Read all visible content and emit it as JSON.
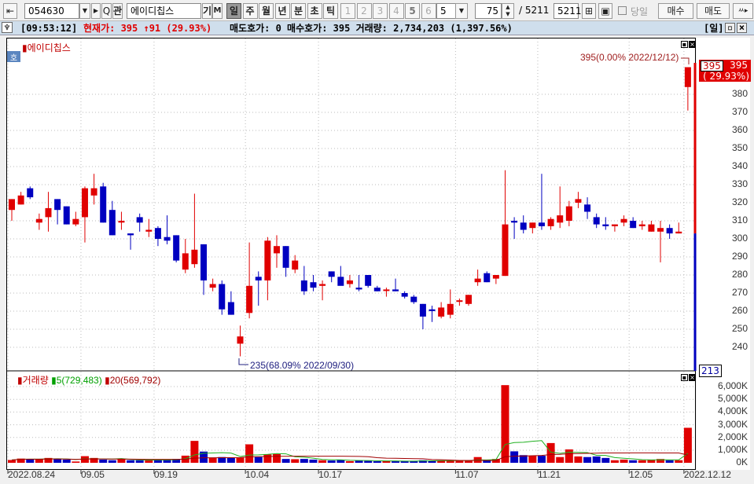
{
  "toolbar": {
    "code": "054630",
    "name": "에이디칩스",
    "gi": "기",
    "m": "M",
    "search": "Q",
    "gwan": "관",
    "periods": [
      "일",
      "주",
      "월",
      "년",
      "분",
      "초",
      "틱"
    ],
    "active_period": "일",
    "nums": [
      "1",
      "2",
      "3",
      "4",
      "5",
      "6"
    ],
    "num_select": "5",
    "count": "75",
    "total": "/ 5211",
    "total_box": "5211",
    "today_label": "당일",
    "buy": "매수",
    "sell": "매도",
    "more": "ㅆ▸"
  },
  "info": {
    "time": "[09:53:12]",
    "current": "현재가: 395 ↑91 (29.93%)",
    "rest": "매도호가: 0 매수호가: 395 거래량: 2,734,203 (1,397.56%)",
    "period": "[일]"
  },
  "chart_data": {
    "type": "candlestick",
    "title": "에이디칩스",
    "price_axis": [
      "380",
      "370",
      "360",
      "350",
      "340",
      "330",
      "320",
      "310",
      "300",
      "290",
      "280",
      "270",
      "260",
      "250",
      "240"
    ],
    "price_range": [
      225,
      400
    ],
    "high_label": "395(0.00% 2022/12/12)",
    "low_label": "235(68.09% 2022/09/30)",
    "current_tag": "395",
    "current_price": "395",
    "current_pct": "( 29.93%)",
    "range_low_tag": "213",
    "colors": {
      "up": "#e00000",
      "down": "#0000c0"
    },
    "ohlc": [
      [
        316,
        322,
        310,
        322
      ],
      [
        319,
        326,
        319,
        324
      ],
      [
        328,
        329,
        322,
        323
      ],
      [
        309,
        314,
        305,
        311
      ],
      [
        312,
        326,
        304,
        317
      ],
      [
        322,
        322,
        308,
        316
      ],
      [
        318,
        318,
        308,
        308
      ],
      [
        308,
        315,
        307,
        311
      ],
      [
        312,
        329,
        298,
        328
      ],
      [
        324,
        336,
        319,
        328
      ],
      [
        329,
        331,
        309,
        309
      ],
      [
        316,
        321,
        302,
        302
      ],
      [
        309,
        315,
        305,
        310
      ],
      [
        303,
        303,
        294,
        302
      ],
      [
        312,
        314,
        304,
        309
      ],
      [
        304,
        311,
        301,
        305
      ],
      [
        306,
        307,
        296,
        300
      ],
      [
        301,
        313,
        297,
        299
      ],
      [
        302,
        302,
        287,
        288
      ],
      [
        283,
        300,
        281,
        292
      ],
      [
        286,
        325,
        284,
        294
      ],
      [
        297,
        297,
        269,
        277
      ],
      [
        273,
        278,
        271,
        275
      ],
      [
        275,
        277,
        258,
        261
      ],
      [
        265,
        271,
        258,
        258
      ],
      [
        242,
        252,
        235,
        246
      ],
      [
        259,
        298,
        256,
        274
      ],
      [
        279,
        282,
        263,
        277
      ],
      [
        277,
        301,
        266,
        299
      ],
      [
        292,
        302,
        284,
        296
      ],
      [
        296,
        296,
        279,
        284
      ],
      [
        283,
        291,
        281,
        288
      ],
      [
        277,
        285,
        269,
        271
      ],
      [
        276,
        280,
        271,
        273
      ],
      [
        274,
        277,
        266,
        275
      ],
      [
        282,
        282,
        276,
        279
      ],
      [
        279,
        285,
        275,
        274
      ],
      [
        275,
        280,
        273,
        277
      ],
      [
        273,
        280,
        271,
        272
      ],
      [
        280,
        280,
        273,
        274
      ],
      [
        273,
        274,
        271,
        271
      ],
      [
        272,
        273,
        268,
        272
      ],
      [
        272,
        278,
        271,
        271
      ],
      [
        270,
        271,
        267,
        268
      ],
      [
        268,
        269,
        264,
        265
      ],
      [
        264,
        264,
        250,
        257
      ],
      [
        261,
        263,
        254,
        260
      ],
      [
        257,
        265,
        256,
        262
      ],
      [
        258,
        272,
        256,
        264
      ],
      [
        266,
        267,
        263,
        266
      ],
      [
        264,
        269,
        263,
        269
      ],
      [
        276,
        283,
        274,
        278
      ],
      [
        281,
        282,
        276,
        276
      ],
      [
        278,
        280,
        275,
        280
      ],
      [
        279.5,
        338,
        279.5,
        308
      ],
      [
        310,
        312,
        300,
        309
      ],
      [
        309,
        313,
        303,
        305
      ],
      [
        306,
        309,
        303,
        309
      ],
      [
        309,
        336,
        305,
        307
      ],
      [
        307,
        312,
        305,
        311
      ],
      [
        309,
        329,
        306,
        313
      ],
      [
        310,
        321,
        307,
        318
      ],
      [
        320,
        326,
        317,
        322
      ],
      [
        319,
        323,
        311,
        315
      ],
      [
        312,
        314,
        306,
        308
      ],
      [
        308,
        312,
        305,
        307
      ],
      [
        307,
        308,
        304,
        308
      ],
      [
        309,
        313,
        307,
        311
      ],
      [
        310,
        312,
        306,
        306
      ],
      [
        307,
        310,
        305,
        308
      ],
      [
        304,
        310,
        304,
        308
      ],
      [
        304,
        310,
        287,
        306
      ],
      [
        306,
        308,
        300,
        303
      ],
      [
        303,
        309,
        303,
        304
      ],
      [
        384,
        395,
        371,
        395
      ]
    ],
    "volume_label": "거래량",
    "ma5_label": "5(729,483)",
    "ma20_label": "20(569,792)",
    "volume_axis": [
      "6,000K",
      "5,000K",
      "4,000K",
      "3,000K",
      "2,000K",
      "1,000K",
      "0K"
    ],
    "volume_k": [
      220,
      330,
      300,
      280,
      380,
      280,
      250,
      100,
      520,
      380,
      250,
      200,
      290,
      200,
      200,
      200,
      240,
      270,
      300,
      560,
      1720,
      880,
      380,
      450,
      380,
      400,
      1450,
      450,
      650,
      680,
      300,
      280,
      300,
      250,
      200,
      180,
      230,
      130,
      180,
      150,
      120,
      150,
      120,
      130,
      150,
      200,
      180,
      180,
      150,
      170,
      180,
      450,
      180,
      300,
      6100,
      900,
      600,
      550,
      550,
      1550,
      450,
      1050,
      500,
      450,
      500,
      380,
      200,
      250,
      200,
      200,
      250,
      300,
      200,
      200,
      2750
    ],
    "x_ticks": [
      {
        "i": 0,
        "label": "2022.08.24"
      },
      {
        "i": 8,
        "label": "09.05"
      },
      {
        "i": 16,
        "label": "09.19"
      },
      {
        "i": 26,
        "label": "10.04"
      },
      {
        "i": 34,
        "label": "10.17"
      },
      {
        "i": 49,
        "label": "11.07"
      },
      {
        "i": 58,
        "label": "11.21"
      },
      {
        "i": 68,
        "label": "12.05"
      },
      {
        "i": 74,
        "label": "2022.12.12"
      }
    ]
  }
}
